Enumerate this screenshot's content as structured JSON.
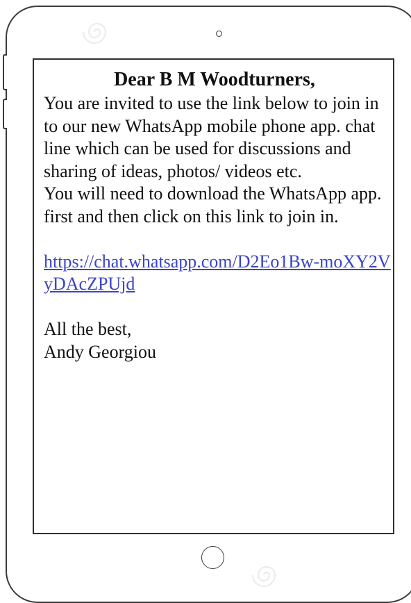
{
  "message": {
    "greeting": "Dear B M Woodturners,",
    "paragraph_1": "You are invited to use the link below to join in to our new WhatsApp mobile phone app. chat line which can be used for discussions and sharing of ideas, photos/ videos etc.",
    "paragraph_2": "You will need to download the WhatsApp app. first and then click on this link to join in.",
    "link_text": "https://chat.whatsapp.com/D2Eo1Bw-moXY2VyDAcZPUjd",
    "signoff": "All the best,",
    "signature": "Andy Georgiou"
  },
  "colors": {
    "link": "#3b44c9",
    "outline": "#3a3a3a"
  },
  "icons": {
    "camera": "camera-icon",
    "home_button": "home-button-icon"
  }
}
